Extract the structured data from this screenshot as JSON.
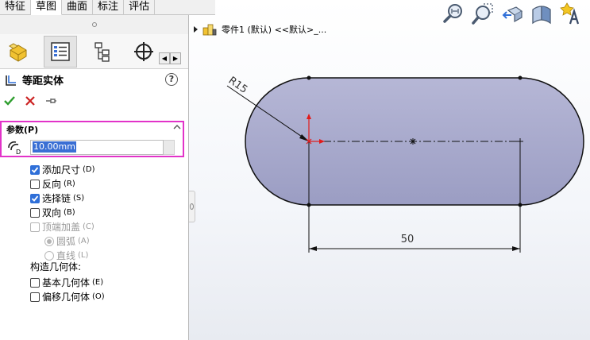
{
  "command_tabs": [
    {
      "label": "特征"
    },
    {
      "label": "草图"
    },
    {
      "label": "曲面"
    },
    {
      "label": "标注"
    },
    {
      "label": "评估"
    }
  ],
  "active_tab": "草图",
  "property_manager": {
    "title": "等距实体",
    "icon": "offset-entities-icon",
    "help": "?",
    "section_title": "参数(P)",
    "offset_value": "10.00mm",
    "options": {
      "add_dimensions": {
        "label": "添加尺寸",
        "mnemonic": "(D)",
        "checked": true
      },
      "reverse": {
        "label": "反向",
        "mnemonic": "(R)",
        "checked": false
      },
      "select_chain": {
        "label": "选择链",
        "mnemonic": "(S)",
        "checked": true
      },
      "bidirectional": {
        "label": "双向",
        "mnemonic": "(B)",
        "checked": false
      },
      "cap_ends": {
        "label": "顶端加盖",
        "mnemonic": "(C)",
        "checked": false,
        "disabled": true
      },
      "arcs": {
        "label": "圆弧",
        "mnemonic": "(A)",
        "selected": true,
        "disabled": true
      },
      "lines": {
        "label": "直线",
        "mnemonic": "(L)",
        "selected": false,
        "disabled": true
      }
    },
    "construction_title": "构造几何体:",
    "base_geometry": {
      "label": "基本几何体",
      "mnemonic": "(E)",
      "checked": false
    },
    "offset_geometry": {
      "label": "偏移几何体",
      "mnemonic": "(O)",
      "checked": false
    }
  },
  "tree": {
    "label": "零件1 (默认) <<默认>_..."
  },
  "sketch": {
    "radius_label": "R15",
    "length_label": "50",
    "fill_color": "#aeb0d2",
    "origin_color": "#e21b1b"
  },
  "hud_icons": [
    "zoom-to-fit-icon",
    "zoom-area-icon",
    "previous-view-icon",
    "section-view-icon",
    "appearance-icon"
  ]
}
